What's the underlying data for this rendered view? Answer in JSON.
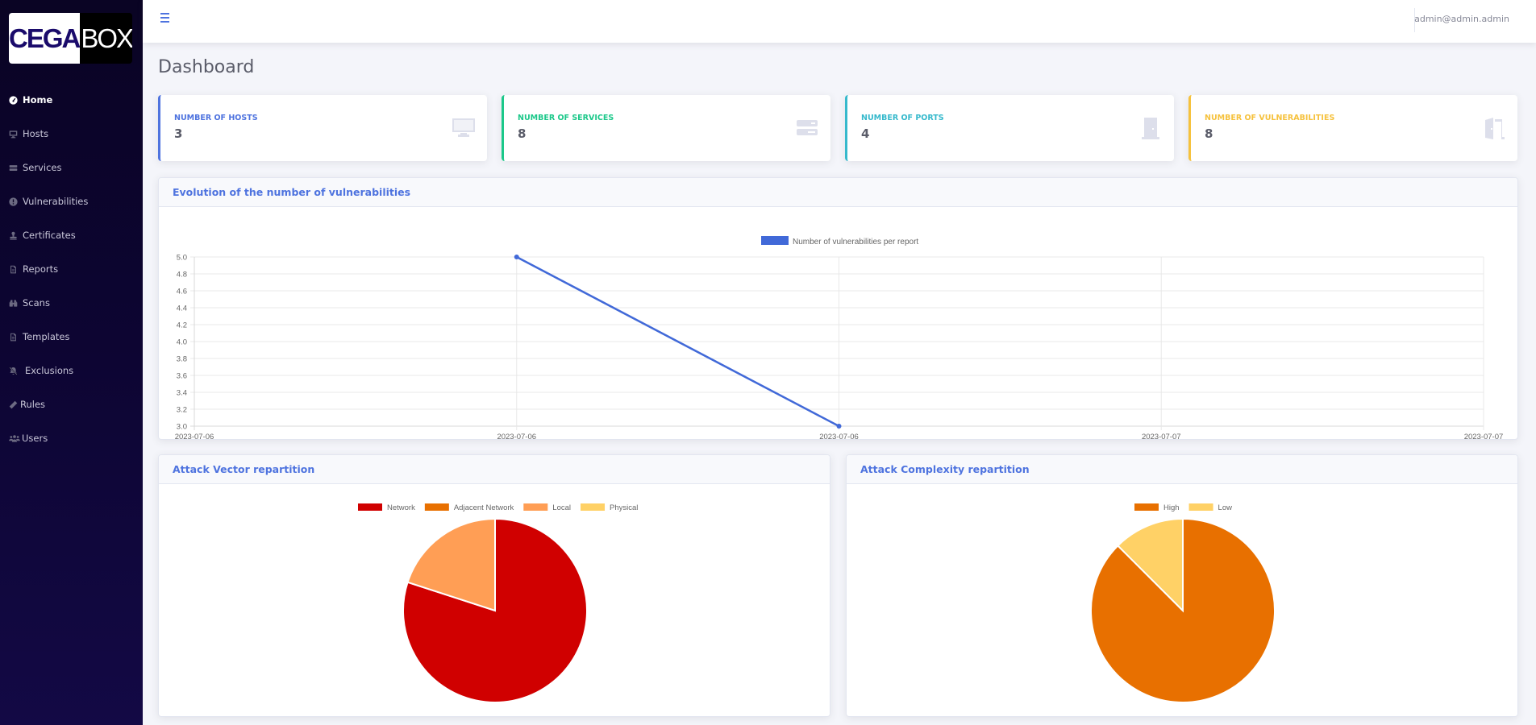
{
  "brand": {
    "left": "CEGA",
    "right": "BOX"
  },
  "sidebar": {
    "items": [
      {
        "label": "Home",
        "icon": "dashboard-icon",
        "active": true
      },
      {
        "label": "Hosts",
        "icon": "desktop-icon"
      },
      {
        "label": "Services",
        "icon": "server-icon"
      },
      {
        "label": "Vulnerabilities",
        "icon": "exclamation-circle-icon"
      },
      {
        "label": "Certificates",
        "icon": "stamp-icon"
      },
      {
        "label": "Reports",
        "icon": "file-pdf-icon"
      },
      {
        "label": "Scans",
        "icon": "binoculars-icon"
      },
      {
        "label": "Templates",
        "icon": "file-alt-icon"
      },
      {
        "label": "Exclusions",
        "icon": "bell-slash-icon"
      },
      {
        "label": "Rules",
        "icon": "ruler-icon"
      },
      {
        "label": "Users",
        "icon": "users-icon"
      }
    ]
  },
  "topbar": {
    "menu_icon": "bars-icon",
    "user_email": "admin@admin.admin"
  },
  "page": {
    "title": "Dashboard"
  },
  "stats": [
    {
      "label": "Number of hosts",
      "value": "3",
      "color": "#4e73df",
      "icon": "desktop-icon"
    },
    {
      "label": "Number of services",
      "value": "8",
      "color": "#1cc88a",
      "icon": "server-icon"
    },
    {
      "label": "Number of ports",
      "value": "4",
      "color": "#36b9cc",
      "icon": "door-closed-icon"
    },
    {
      "label": "Number of vulnerabilities",
      "value": "8",
      "color": "#f6c23e",
      "icon": "door-open-icon"
    }
  ],
  "chart_data": [
    {
      "type": "line",
      "title": "Evolution of the number of vulnerabilities",
      "categories": [
        "2023-07-06",
        "2023-07-06",
        "2023-07-06",
        "2023-07-07",
        "2023-07-07"
      ],
      "series": [
        {
          "name": "Number of vulnerabilities per report",
          "color": "#4169d8",
          "values": [
            null,
            5,
            3,
            null,
            null
          ]
        }
      ],
      "yticks": [
        "3.0",
        "3.2",
        "3.4",
        "3.6",
        "3.8",
        "4.0",
        "4.2",
        "4.4",
        "4.6",
        "4.8",
        "5.0"
      ],
      "ylim": [
        3,
        5
      ],
      "xlabel": "",
      "ylabel": "",
      "grid": true,
      "legend": "top"
    },
    {
      "type": "pie",
      "title": "Attack Vector repartition",
      "labels": [
        "Network",
        "Adjacent Network",
        "Local",
        "Physical"
      ],
      "values": [
        4,
        0,
        1,
        0
      ],
      "colors": [
        "#d00000",
        "#e87000",
        "#ff9e55",
        "#ffd166"
      ],
      "legend": "top"
    },
    {
      "type": "pie",
      "title": "Attack Complexity repartition",
      "labels": [
        "High",
        "Low"
      ],
      "values": [
        7,
        1
      ],
      "colors": [
        "#e87000",
        "#ffd166"
      ],
      "legend": "top"
    }
  ]
}
